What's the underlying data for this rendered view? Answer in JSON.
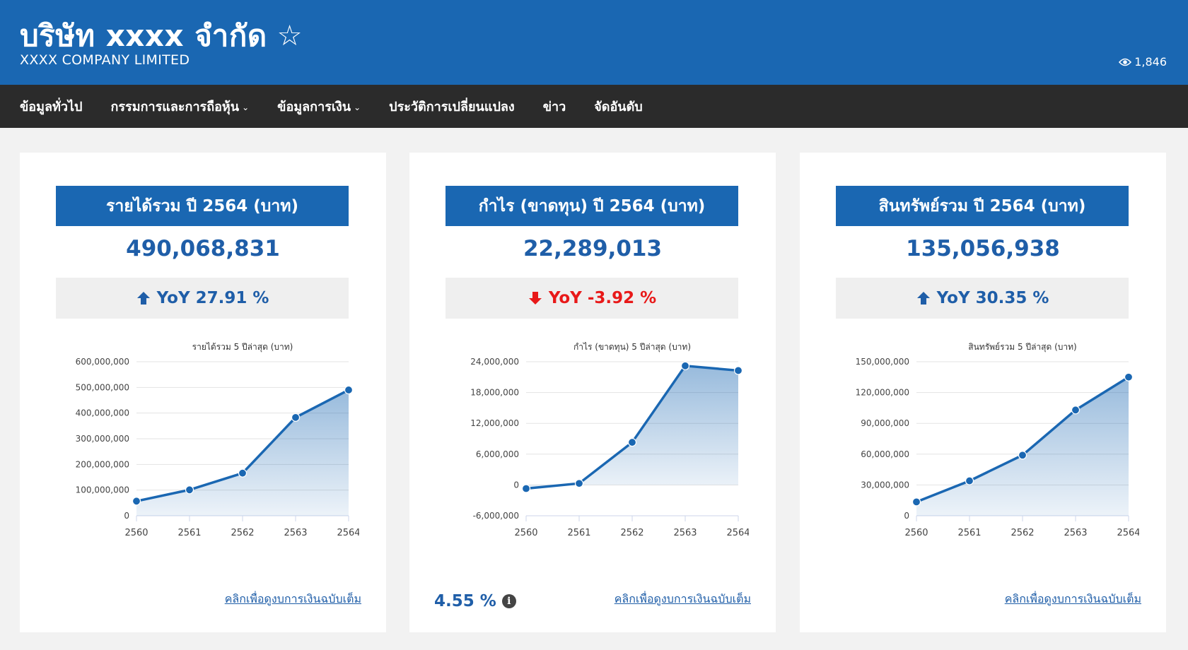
{
  "header": {
    "title": "บริษัท xxxx จำกัด",
    "star_icon": "☆",
    "subtitle": "XXXX COMPANY LIMITED",
    "views": "1,846"
  },
  "nav": {
    "items": [
      {
        "label": "ข้อมูลทั่วไป",
        "dropdown": false
      },
      {
        "label": "กรรมการและการถือหุ้น",
        "dropdown": true
      },
      {
        "label": "ข้อมูลการเงิน",
        "dropdown": true
      },
      {
        "label": "ประวัติการเปลี่ยนแปลง",
        "dropdown": false
      },
      {
        "label": "ข่าว",
        "dropdown": false
      },
      {
        "label": "จัดอันดับ",
        "dropdown": false
      }
    ]
  },
  "colors": {
    "primary": "#1a67b2",
    "nav_bg": "#2b2b2b",
    "up": "#1f5ea8",
    "down": "#e81919"
  },
  "cards": [
    {
      "heading": "รายได้รวม ปี 2564 (บาท)",
      "value": "490,068,831",
      "yoy_label": "YoY 27.91 %",
      "direction": "up",
      "link": "คลิกเพื่อดูงบการเงินฉบับเต็ม"
    },
    {
      "heading": "กำไร (ขาดทุน) ปี 2564 (บาท)",
      "value": "22,289,013",
      "yoy_label": "YoY -3.92 %",
      "direction": "down",
      "link": "คลิกเพื่อดูงบการเงินฉบับเต็ม",
      "margin": "4.55 %",
      "info_icon": "i"
    },
    {
      "heading": "สินทรัพย์รวม ปี 2564 (บาท)",
      "value": "135,056,938",
      "yoy_label": "YoY 30.35 %",
      "direction": "up",
      "link": "คลิกเพื่อดูงบการเงินฉบับเต็ม"
    }
  ],
  "chart_data": [
    {
      "type": "area",
      "title": "รายได้รวม 5 ปีล่าสุด (บาท)",
      "categories": [
        "2560",
        "2561",
        "2562",
        "2563",
        "2564"
      ],
      "values": [
        57000000,
        101000000,
        166000000,
        383000000,
        490068831
      ],
      "ylim": [
        0,
        600000000
      ],
      "yticks": [
        0,
        100000000,
        200000000,
        300000000,
        400000000,
        500000000,
        600000000
      ],
      "ytick_labels": [
        "0",
        "100,000,000",
        "200,000,000",
        "300,000,000",
        "400,000,000",
        "500,000,000",
        "600,000,000"
      ]
    },
    {
      "type": "area",
      "title": "กำไร (ขาดทุน) 5 ปีล่าสุด (บาท)",
      "categories": [
        "2560",
        "2561",
        "2562",
        "2563",
        "2564"
      ],
      "values": [
        -700000,
        300000,
        8300000,
        23200000,
        22289013
      ],
      "ylim": [
        -6000000,
        24000000
      ],
      "yticks": [
        -6000000,
        0,
        6000000,
        12000000,
        18000000,
        24000000
      ],
      "ytick_labels": [
        "-6,000,000",
        "0",
        "6,000,000",
        "12,000,000",
        "18,000,000",
        "24,000,000"
      ]
    },
    {
      "type": "area",
      "title": "สินทรัพย์รวม 5 ปีล่าสุด (บาท)",
      "categories": [
        "2560",
        "2561",
        "2562",
        "2563",
        "2564"
      ],
      "values": [
        13500000,
        34000000,
        59000000,
        103000000,
        135056938
      ],
      "ylim": [
        0,
        150000000
      ],
      "yticks": [
        0,
        30000000,
        60000000,
        90000000,
        120000000,
        150000000
      ],
      "ytick_labels": [
        "0",
        "30,000,000",
        "60,000,000",
        "90,000,000",
        "120,000,000",
        "150,000,000"
      ]
    }
  ]
}
